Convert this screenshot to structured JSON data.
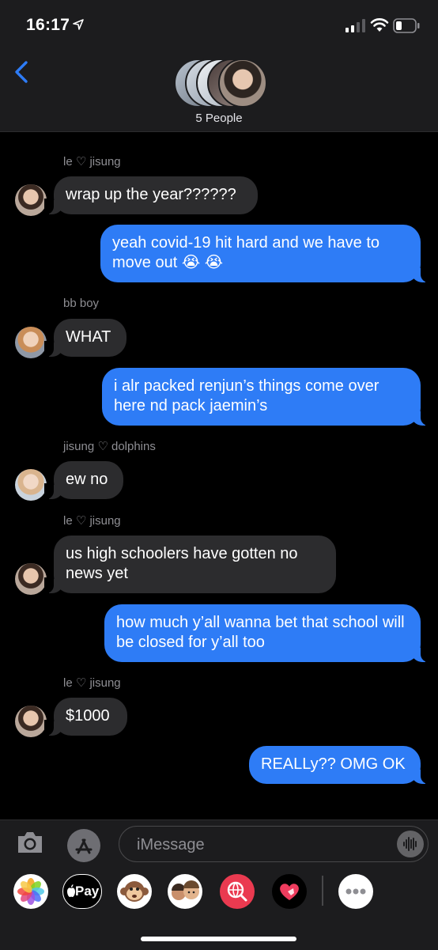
{
  "status": {
    "time": "16:17"
  },
  "header": {
    "back": "back",
    "title": "5 People"
  },
  "messages": [
    {
      "sender": "le ♡ jisung",
      "text": "wrap up the year??????"
    },
    {
      "text": "yeah covid-19 hit hard and we have to move out 😭 😭"
    },
    {
      "sender": "bb boy",
      "text": "WHAT"
    },
    {
      "text": "i alr packed renjun’s things come over here nd pack jaemin’s"
    },
    {
      "sender": "jisung ♡ dolphins",
      "text": "ew no"
    },
    {
      "sender": "le ♡ jisung",
      "text": "us high schoolers have gotten no news yet"
    },
    {
      "text": "how much y’all wanna bet that school will be closed for y’all too"
    },
    {
      "sender": "le ♡ jisung",
      "text": "$1000"
    },
    {
      "text": "REALLy?? OMG OK"
    }
  ],
  "input": {
    "placeholder": "iMessage"
  },
  "apps": {
    "applepay_label": "Pay"
  },
  "colors": {
    "outgoing": "#2e7cf6",
    "incoming": "#2c2c2e",
    "accent": "#2e7cf6"
  },
  "icons": [
    "location-arrow-icon",
    "signal-icon",
    "wifi-icon",
    "battery-icon",
    "chevron-left-icon",
    "camera-icon",
    "app-store-icon",
    "audio-waveform-icon",
    "photos-icon",
    "apple-pay-icon",
    "animoji-icon",
    "memoji-icon",
    "image-search-icon",
    "digital-touch-icon",
    "more-icon"
  ]
}
